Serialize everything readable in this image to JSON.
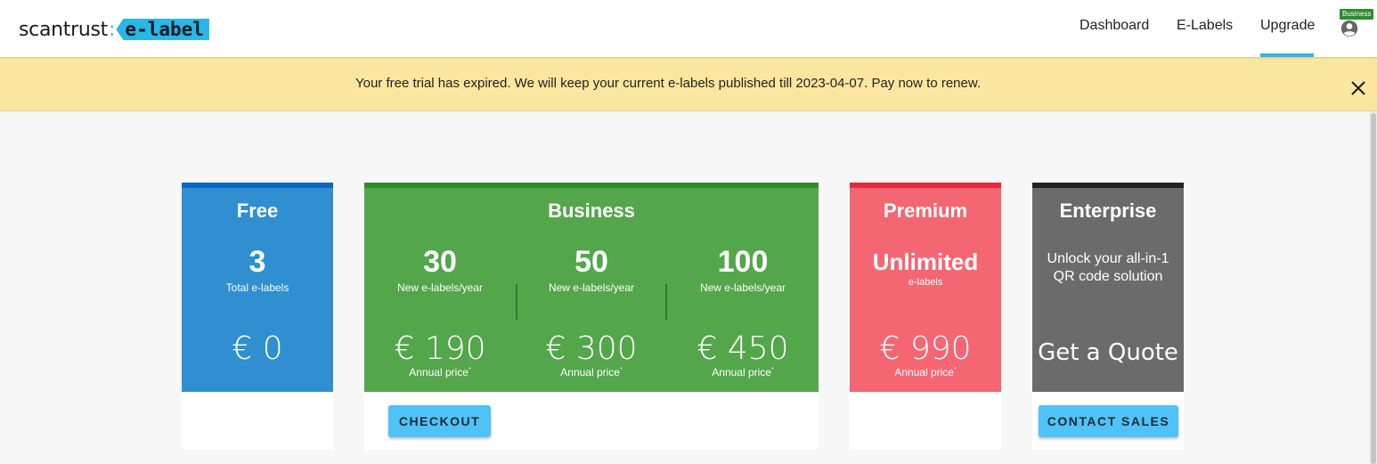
{
  "header": {
    "logo_text": "scantrust",
    "logo_colon": ":",
    "logo_tag": "e-label",
    "nav": [
      {
        "label": "Dashboard"
      },
      {
        "label": "E-Labels"
      },
      {
        "label": "Upgrade",
        "active": true
      }
    ],
    "user_badge": "Business",
    "user_icon": "account-circle-icon"
  },
  "banner": {
    "text": "Your free trial has expired. We will keep your current e-labels published till 2023-04-07. Pay now to renew.",
    "close_icon": "close-icon"
  },
  "plans": {
    "free": {
      "title": "Free",
      "count": "3",
      "count_label": "Total e-labels",
      "price": "€ 0",
      "color": "#2f8fd0",
      "accent": "#0a66c2"
    },
    "business": {
      "title": "Business",
      "color": "#54a64b",
      "accent": "#2e8b2e",
      "tiers": [
        {
          "count": "30",
          "count_label": "New e-labels/year",
          "price": "€ 190",
          "price_label": "Annual price",
          "mark": "*"
        },
        {
          "count": "50",
          "count_label": "New e-labels/year",
          "price": "€ 300",
          "price_label": "Annual price",
          "mark": "*"
        },
        {
          "count": "100",
          "count_label": "New e-labels/year",
          "price": "€ 450",
          "price_label": "Annual price",
          "mark": "*"
        }
      ],
      "button": "CHECKOUT"
    },
    "premium": {
      "title": "Premium",
      "count": "Unlimited",
      "count_label": "e-labels",
      "price": "€ 990",
      "price_label": "Annual price",
      "mark": "*",
      "color": "#f56673",
      "accent": "#e8283b"
    },
    "enterprise": {
      "title": "Enterprise",
      "tagline_1": "Unlock your all-in-1",
      "tagline_2": "QR code solution",
      "cta": "Get a Quote",
      "button": "CONTACT SALES",
      "color": "#6b6b6b",
      "accent": "#222222"
    }
  }
}
